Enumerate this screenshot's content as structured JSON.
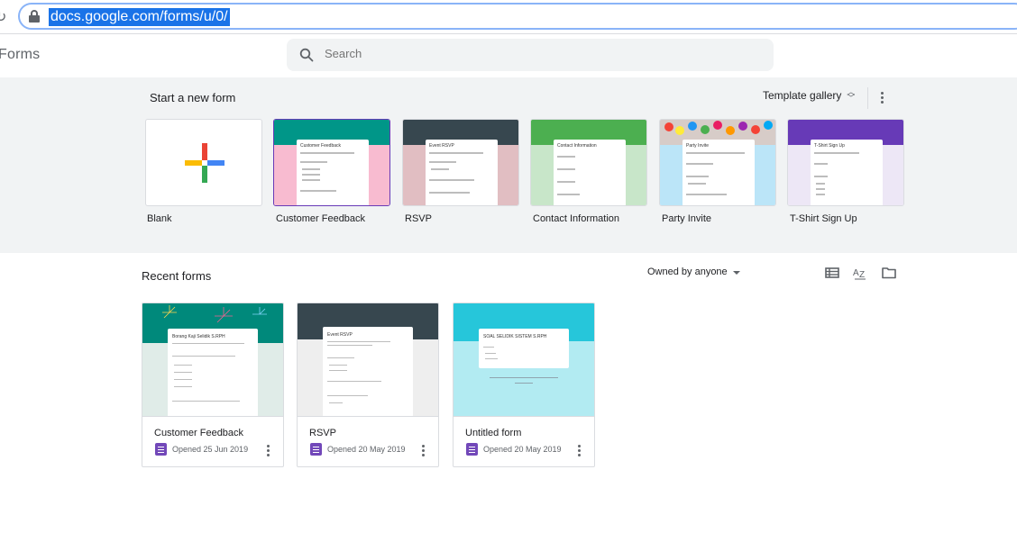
{
  "browser": {
    "url": "docs.google.com/forms/u/0/",
    "reload_glyph": "↻",
    "icons": [
      "reload-icon",
      "lock-icon"
    ]
  },
  "header": {
    "app_title": "Forms",
    "search": {
      "placeholder": "Search",
      "icon": "search-icon"
    }
  },
  "templates": {
    "section_title": "Start a new form",
    "gallery_label": "Template gallery",
    "gallery_icon": "unfold-arrows-icon",
    "more_icon": "more-vert-icon",
    "items": [
      {
        "label": "Blank"
      },
      {
        "label": "Customer Feedback",
        "header_color": "#009688",
        "bg_color": "#f8bbd0",
        "card_title": "Customer Feedback"
      },
      {
        "label": "RSVP",
        "header_color": "#37474f",
        "bg_color": "#e1bec2",
        "card_title": "Event RSVP"
      },
      {
        "label": "Contact Information",
        "header_color": "#4caf50",
        "bg_color": "#c8e6c9",
        "card_title": "Contact Information"
      },
      {
        "label": "Party Invite",
        "header_color": "#d7ccc8",
        "bg_color": "#bbe5f8",
        "card_title": "Party Invite"
      },
      {
        "label": "T-Shirt Sign Up",
        "header_color": "#673ab7",
        "bg_color": "#ede7f6",
        "card_title": "T-Shirt Sign Up"
      }
    ]
  },
  "recent": {
    "section_title": "Recent forms",
    "owner_filter": "Owned by anyone",
    "view_icons": [
      "list-view-icon",
      "sort-az-icon",
      "folder-icon"
    ],
    "items": [
      {
        "title": "Customer Feedback",
        "opened": "Opened 25 Jun 2019",
        "card_title": "Borang Kaji Selidik S.RPH",
        "header_color": "#00897b",
        "bg_color": "#e0ece8"
      },
      {
        "title": "RSVP",
        "opened": "Opened 20 May 2019",
        "card_title": "Event RSVP",
        "header_color": "#37474f",
        "bg_color": "#eeeeee"
      },
      {
        "title": "Untitled form",
        "opened": "Opened 20 May 2019",
        "card_title": "SOAL SELIDIK SISTEM S.RPH",
        "header_color": "#26c6da",
        "bg_color": "#b2ebf2"
      }
    ]
  },
  "colors": {
    "accent": "#1a73e8",
    "forms_purple": "#7248b9",
    "band_bg": "#f1f3f4"
  }
}
